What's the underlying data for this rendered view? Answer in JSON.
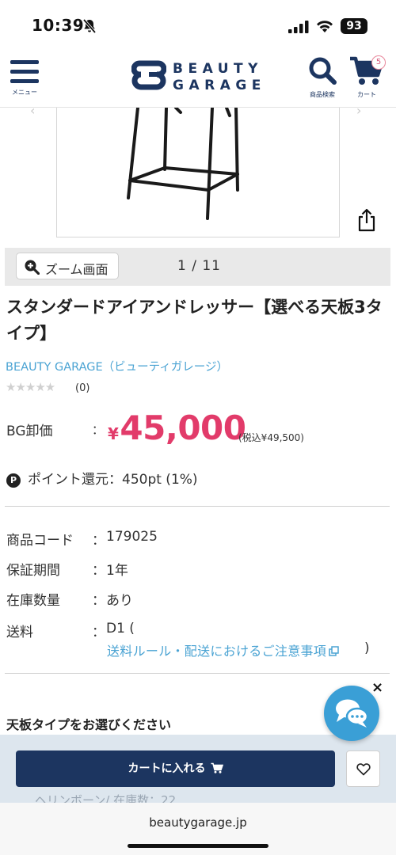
{
  "status_bar": {
    "time": "10:39",
    "battery": "93"
  },
  "header": {
    "menu_label": "メニュー",
    "logo_line1": "BEAUTY",
    "logo_line2": "GARAGE",
    "search_label": "商品検索",
    "cart_label": "カート",
    "cart_count": "5"
  },
  "gallery": {
    "zoom_label": "ズーム画面",
    "page_indicator": "1 / 11"
  },
  "product": {
    "title": "スタンダードアイアンドレッサー【選べる天板3タイプ】",
    "brand": "BEAUTY GARAGE（ビューティガレージ）",
    "rating_stars": "★★★★★",
    "review_count": "(0)",
    "price_label": "BG卸価",
    "price_colon": "：",
    "price_currency": "¥",
    "price_value": "45,000",
    "price_with_tax": "(税込¥49,500)",
    "points_badge": "P",
    "points_text": "ポイント還元：450pt (1%)"
  },
  "specs": [
    {
      "key": "商品コード",
      "colon": "：",
      "value": "179025"
    },
    {
      "key": "保証期間",
      "colon": "：",
      "value": "1年"
    },
    {
      "key": "在庫数量",
      "colon": "：",
      "value": "あり"
    },
    {
      "key": "送料",
      "colon": "：",
      "value": "D1 ("
    }
  ],
  "shipping_link": "送料ルール・配送におけるご注意事項",
  "shipping_close": ")",
  "option_heading": "天板タイプをお選びください",
  "option_behind": "ヘリンボーン/ 在庫数：22",
  "chat_close": "×",
  "cart_bar": {
    "add_to_cart": "カートに入れる"
  },
  "browser": {
    "url": "beautygarage.jp"
  },
  "colors": {
    "navy": "#1c3560",
    "price": "#e23b6a",
    "link": "#4aa3d3",
    "chat": "#3a9fd6"
  }
}
